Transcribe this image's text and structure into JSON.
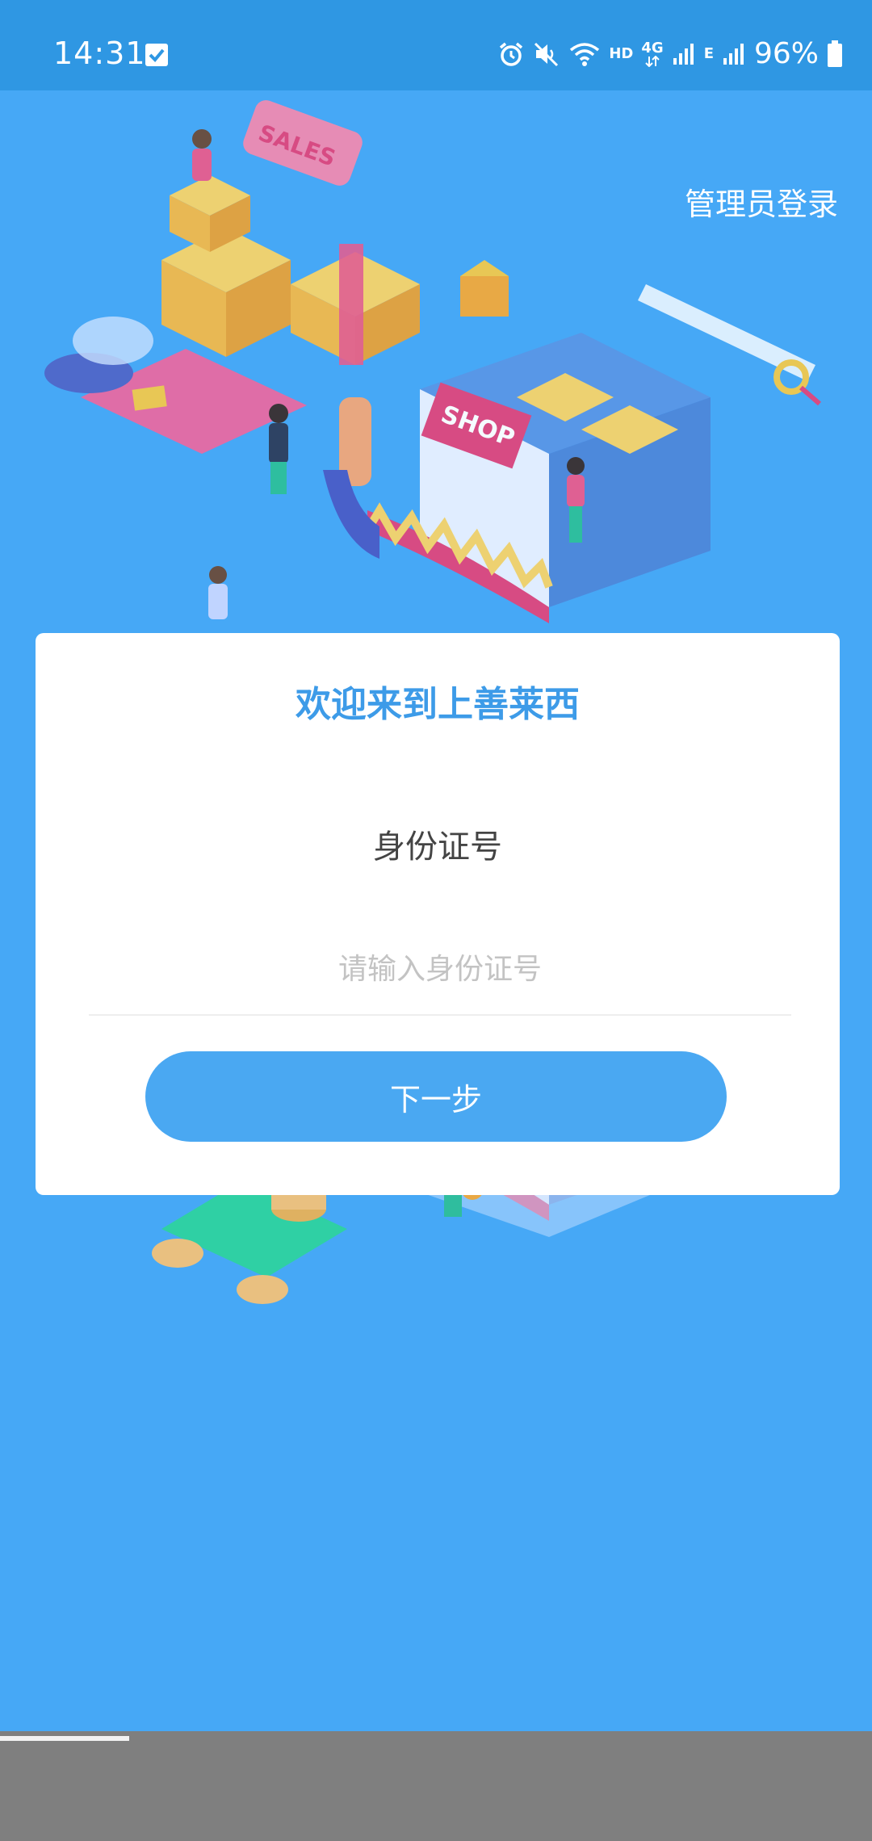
{
  "status_bar": {
    "time": "14:31",
    "hd_label": "HD",
    "network_label": "4G",
    "network_label_2": "E",
    "battery": "96%"
  },
  "header": {
    "admin_login": "管理员登录"
  },
  "login_card": {
    "welcome": "欢迎来到上善莱西",
    "id_label": "身份证号",
    "id_value": "",
    "id_placeholder": "请输入身份证号",
    "next_button": "下一步"
  },
  "colors": {
    "background": "#46a8f6",
    "status_bar": "#2f97e3",
    "accent": "#3d9be8",
    "button": "#4aa8f2",
    "card": "#ffffff"
  }
}
